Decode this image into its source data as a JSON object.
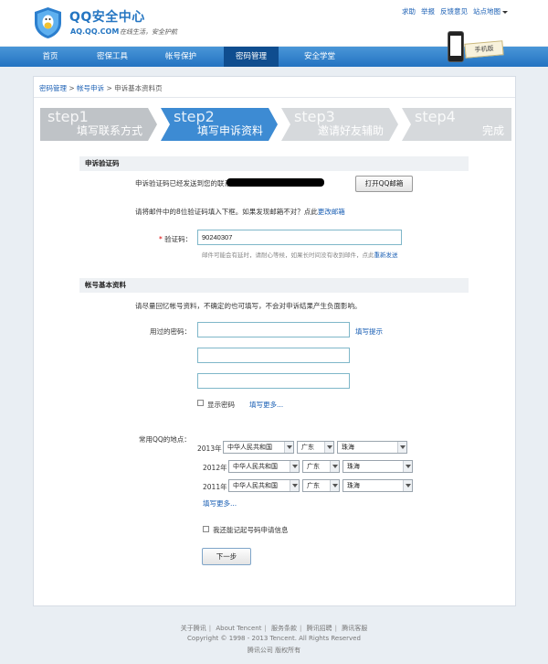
{
  "header": {
    "title": "QQ安全中心",
    "url": "AQ.QQ.COM",
    "slogan": "在线生活，安全护航",
    "links": [
      "求助",
      "举报",
      "反馈意见",
      "站点地图"
    ]
  },
  "nav": {
    "items": [
      {
        "label": "首页"
      },
      {
        "label": "密保工具"
      },
      {
        "label": "帐号保护"
      },
      {
        "label": "密码管理"
      },
      {
        "label": "安全学堂"
      }
    ],
    "active": "密码管理",
    "promo": "手机版"
  },
  "breadcrumb": [
    "密码管理",
    "帐号申诉",
    "申诉基本资料页"
  ],
  "steps": [
    {
      "en": "step1",
      "cn": "填写联系方式",
      "state": "done"
    },
    {
      "en": "step2",
      "cn": "填写申诉资料",
      "state": "active"
    },
    {
      "en": "step3",
      "cn": "邀请好友辅助",
      "state": "todo"
    },
    {
      "en": "step4",
      "cn": "完成",
      "state": "todo"
    }
  ],
  "verify": {
    "section_title": "申诉验证码",
    "sent_text": "申诉验证码已经发送到您的联系邮箱：",
    "open_mail_button": "打开QQ邮箱",
    "hint_text": "请将邮件中的8位验证码填入下框。如果发现邮箱不对？点此",
    "change_mail_link": "更改邮箱",
    "code_label": "验证码：",
    "code_value": "90240307",
    "delay_note": "邮件可能会有延时，请耐心等候，如果长时间没有收到邮件，点此",
    "resend_link": "重新发送"
  },
  "account": {
    "section_title": "帐号基本资料",
    "intro": "请尽量回忆帐号资料，不确定的也可填写，不会对申诉结果产生负面影响。",
    "password_label": "用过的密码：",
    "password_tip_link": "填写提示",
    "show_password_label": "显示密码",
    "more_link": "填写更多...",
    "location_label": "常用QQ的地点：",
    "locations": [
      {
        "year": "2013年",
        "country": "中华人民共和国",
        "province": "广东",
        "city": "珠海"
      },
      {
        "year": "2012年",
        "country": "中华人民共和国",
        "province": "广东",
        "city": "珠海"
      },
      {
        "year": "2011年",
        "country": "中华人民共和国",
        "province": "广东",
        "city": "珠海"
      }
    ],
    "location_more_link": "填写更多...",
    "remember_label": "我还能记起号码申请信息",
    "next_button": "下一步"
  },
  "footer": {
    "links": [
      "关于腾讯",
      "About Tencent",
      "服务条款",
      "腾讯招聘",
      "腾讯客服"
    ],
    "copyright": "Copyright © 1998 - 2013 Tencent. All Rights Reserved",
    "company": "腾讯公司 版权所有"
  }
}
